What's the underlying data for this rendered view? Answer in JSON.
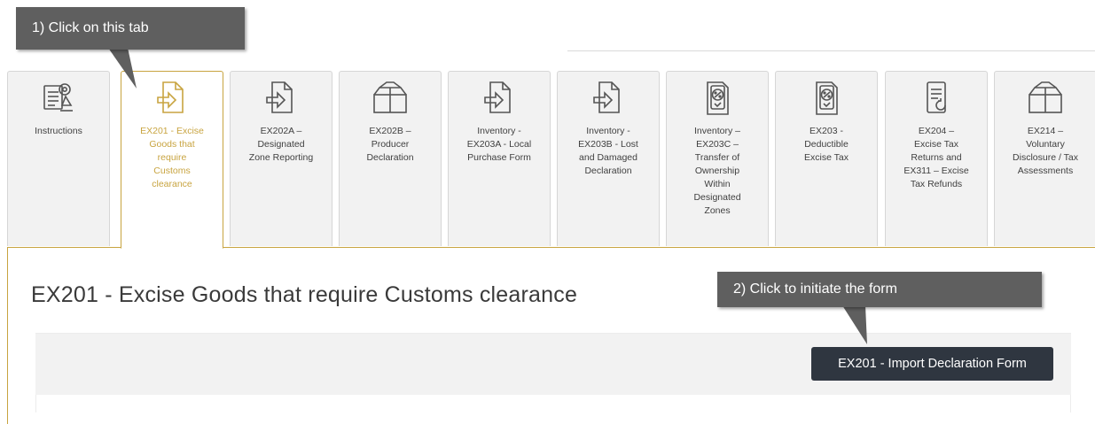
{
  "callouts": {
    "step1": "1) Click on this tab",
    "step2": "2) Click to initiate the form"
  },
  "tabs": [
    {
      "label": "Instructions",
      "icon": "instructions-icon",
      "active": false
    },
    {
      "label": "EX201 - Excise\nGoods that\nrequire\nCustoms\nclearance",
      "icon": "document-import-icon",
      "active": true
    },
    {
      "label": "EX202A –\nDesignated\nZone Reporting",
      "icon": "document-import-icon",
      "active": false
    },
    {
      "label": "EX202B –\nProducer\nDeclaration",
      "icon": "box-icon",
      "active": false
    },
    {
      "label": "Inventory -\nEX203A - Local\nPurchase Form",
      "icon": "document-import-icon",
      "active": false
    },
    {
      "label": "Inventory -\nEX203B - Lost\nand Damaged\nDeclaration",
      "icon": "document-import-icon",
      "active": false
    },
    {
      "label": "Inventory –\nEX203C –\nTransfer of\nOwnership\nWithin\nDesignated\nZones",
      "icon": "percent-document-icon",
      "active": false
    },
    {
      "label": "EX203 -\nDeductible\nExcise Tax",
      "icon": "percent-document-icon",
      "active": false
    },
    {
      "label": "EX204 –\nExcise Tax\nReturns and\nEX311 – Excise\nTax Refunds",
      "icon": "refund-document-icon",
      "active": false
    },
    {
      "label": "EX214 –\nVoluntary\nDisclosure / Tax\nAssessments",
      "icon": "box-icon",
      "active": false
    }
  ],
  "main": {
    "title": "EX201 - Excise Goods that require Customs clearance",
    "button_label": "EX201 - Import Declaration Form"
  },
  "colors": {
    "accent": "#c8a440",
    "button_bg": "#2f3640",
    "callout_bg": "#5f5f5f",
    "tab_bg": "#f2f2f2"
  }
}
